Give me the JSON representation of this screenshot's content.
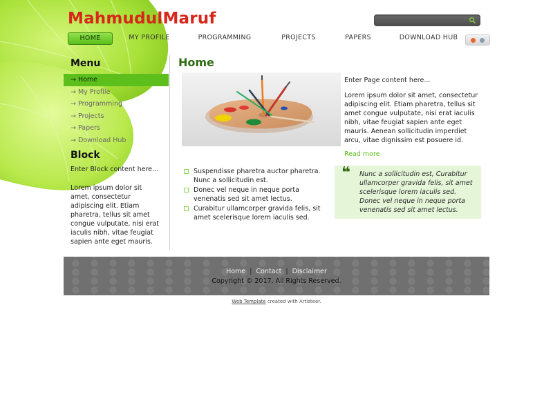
{
  "site": {
    "title": "MahmudulMaruf"
  },
  "search": {
    "placeholder": "",
    "icon": "search-icon"
  },
  "nav": {
    "items": [
      {
        "label": "HOME",
        "active": true
      },
      {
        "label": "MY PROFILE"
      },
      {
        "label": "PROGRAMMING"
      },
      {
        "label": "PROJECTS"
      },
      {
        "label": "PAPERS"
      },
      {
        "label": "DOWNLOAD HUB"
      }
    ]
  },
  "style_switch": {
    "colors": [
      "#e8662a",
      "#8a9aa8"
    ]
  },
  "sidebar": {
    "menu_title": "Menu",
    "menu": [
      {
        "label": "Home",
        "active": true
      },
      {
        "label": "My Profile"
      },
      {
        "label": "Programming"
      },
      {
        "label": "Projects"
      },
      {
        "label": "Papers"
      },
      {
        "label": "Download Hub"
      }
    ],
    "block_title": "Block",
    "block_intro": "Enter Block content here...",
    "block_text": "Lorem ipsum dolor sit amet, consectetur adipiscing elit. Etiam pharetra, tellus sit amet congue vulputate, nisi erat iaculis nibh, vitae feugiat sapien ante eget mauris."
  },
  "content": {
    "title": "Home",
    "intro": "Enter Page content here...",
    "lorem": "Lorem ipsum dolor sit amet, consectetur adipiscing elit. Etiam pharetra, tellus sit amet congue vulputate, nisi erat iaculis nibh, vitae feugiat sapien ante eget mauris. Aenean sollicitudin imperdiet arcu, vitae dignissim est posuere id.",
    "read_more": "Read more",
    "bullets": [
      "Suspendisse pharetra auctor pharetra. Nunc a sollicitudin est.",
      "Donec vel neque in neque porta venenatis sed sit amet lectus.",
      "Curabitur ullamcorper gravida felis, sit amet scelerisque lorem iaculis sed."
    ],
    "quote": "Nunc a sollicitudin est, Curabitur ullamcorper gravida felis, sit amet scelerisque lorem iaculis sed. Donec vel neque in neque porta venenatis sed sit amet lectus."
  },
  "footer": {
    "links": [
      "Home",
      "Contact",
      "Disclaimer"
    ],
    "separator": "|",
    "copyright": "Copyright © 2017. All Rights Reserved."
  },
  "credit": {
    "link": "Web Template",
    "text": " created with Artisteer."
  },
  "colors": {
    "accent": "#5cbf1c",
    "title_red": "#d7261a",
    "heading_green": "#2d6b11",
    "quote_bg": "#e4f5d8",
    "footer_bg": "#707070"
  }
}
